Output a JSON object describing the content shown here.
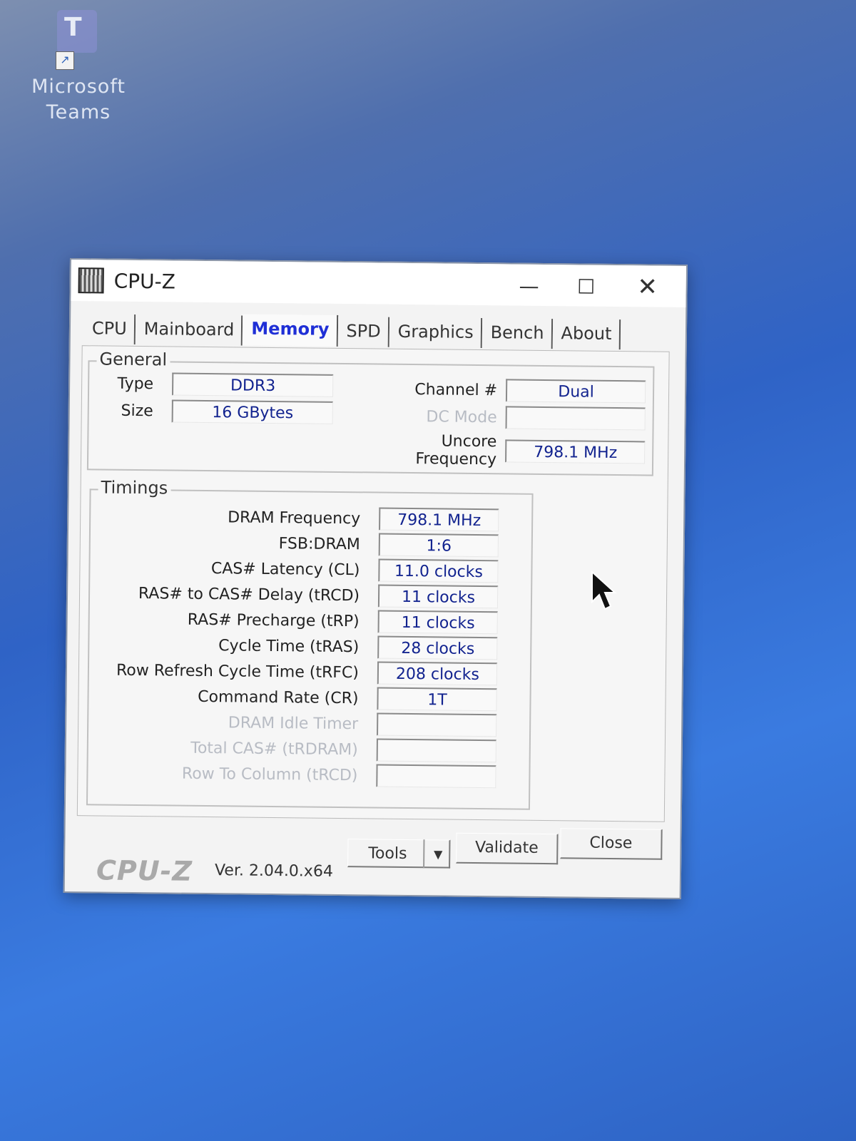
{
  "desktop": {
    "icon_letter": "T",
    "icon_label_line1": "Microsoft",
    "icon_label_line2": "Teams"
  },
  "window": {
    "title": "CPU-Z",
    "minimize_glyph": "—",
    "maximize_glyph": "☐",
    "close_glyph": "✕"
  },
  "tabs": [
    {
      "label": "CPU"
    },
    {
      "label": "Mainboard"
    },
    {
      "label": "Memory",
      "active": true
    },
    {
      "label": "SPD"
    },
    {
      "label": "Graphics"
    },
    {
      "label": "Bench"
    },
    {
      "label": "About"
    }
  ],
  "general": {
    "label": "General",
    "type_label": "Type",
    "type_value": "DDR3",
    "size_label": "Size",
    "size_value": "16 GBytes",
    "channel_label": "Channel #",
    "channel_value": "Dual",
    "dcmode_label": "DC Mode",
    "dcmode_value": "",
    "uncore_label": "Uncore Frequency",
    "uncore_value": "798.1 MHz"
  },
  "timings": {
    "label": "Timings",
    "rows": [
      {
        "label": "DRAM Frequency",
        "value": "798.1 MHz"
      },
      {
        "label": "FSB:DRAM",
        "value": "1:6"
      },
      {
        "label": "CAS# Latency (CL)",
        "value": "11.0 clocks"
      },
      {
        "label": "RAS# to CAS# Delay (tRCD)",
        "value": "11 clocks"
      },
      {
        "label": "RAS# Precharge (tRP)",
        "value": "11 clocks"
      },
      {
        "label": "Cycle Time (tRAS)",
        "value": "28 clocks"
      },
      {
        "label": "Row Refresh Cycle Time (tRFC)",
        "value": "208 clocks"
      },
      {
        "label": "Command Rate (CR)",
        "value": "1T"
      },
      {
        "label": "DRAM Idle Timer",
        "value": "",
        "disabled": true
      },
      {
        "label": "Total CAS# (tRDRAM)",
        "value": "",
        "disabled": true
      },
      {
        "label": "Row To Column (tRCD)",
        "value": "",
        "disabled": true
      }
    ]
  },
  "footer": {
    "brand": "CPU-Z",
    "version": "Ver. 2.04.0.x64",
    "tools_label": "Tools",
    "tools_arrow": "▼",
    "validate_label": "Validate",
    "close_label": "Close"
  }
}
